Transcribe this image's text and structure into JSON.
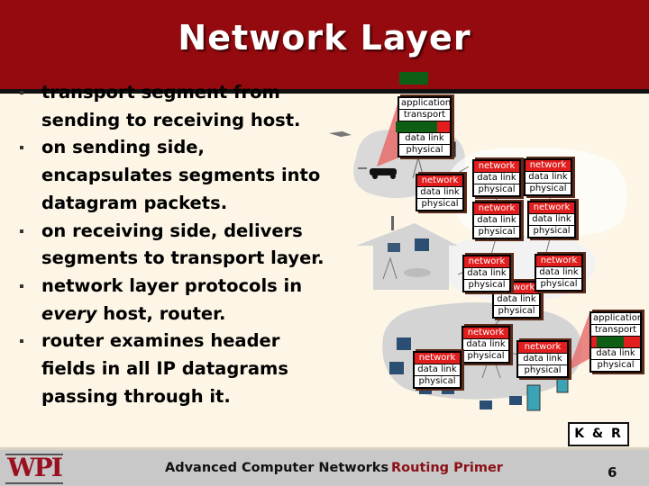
{
  "slide": {
    "title": "Network Layer",
    "bullets": [
      {
        "text": "transport segment from sending to receiving host."
      },
      {
        "text": "on sending side, encapsulates segments into datagram packets."
      },
      {
        "text": "on receiving side, delivers segments to transport layer."
      },
      {
        "pre": "network layer protocols in ",
        "em": "every",
        "post": " host, router."
      },
      {
        "text": "router examines header fields in all IP datagrams passing through it."
      }
    ]
  },
  "diagram": {
    "layers": {
      "application": "application",
      "transport": "transport",
      "network": "network",
      "data_link": "data link",
      "physical": "physical"
    },
    "colors": {
      "network_fill": "#e11d1d",
      "highlight_green": "#0f5e16",
      "cloud_gray": "#d4d4d4"
    },
    "credit": "K & R"
  },
  "footer": {
    "logo": "WPI",
    "course": "Advanced Computer Networks",
    "topic": "Routing Primer",
    "page": "6"
  },
  "colors": {
    "title_bar": "#940a0f",
    "background": "#fdf6e6",
    "footer": "#c8c8c8",
    "topic_text": "#8b0f14"
  }
}
